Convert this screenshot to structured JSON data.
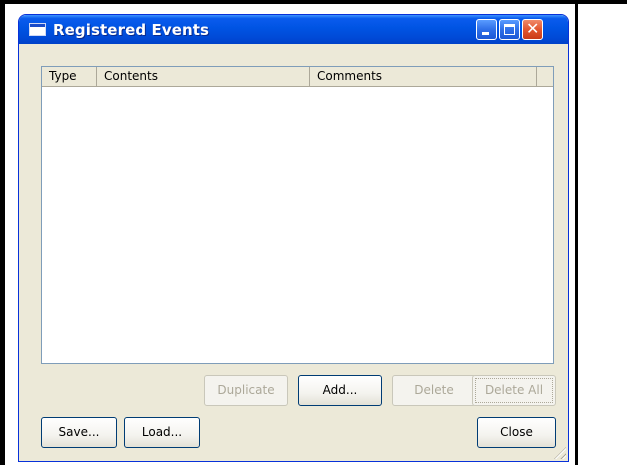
{
  "window": {
    "title": "Registered Events"
  },
  "list": {
    "columns": [
      "Type",
      "Contents",
      "Comments"
    ],
    "rows": []
  },
  "buttons": {
    "duplicate": "Duplicate",
    "add": "Add...",
    "delete": "Delete",
    "delete_all": "Delete All",
    "save": "Save...",
    "load": "Load...",
    "close": "Close"
  },
  "state": {
    "duplicate_enabled": false,
    "add_enabled": true,
    "delete_enabled": false,
    "delete_all_enabled": false
  },
  "colors": {
    "titlebar": "#0054e3",
    "window_bg": "#ece9d8",
    "close_button": "#e2552e"
  }
}
